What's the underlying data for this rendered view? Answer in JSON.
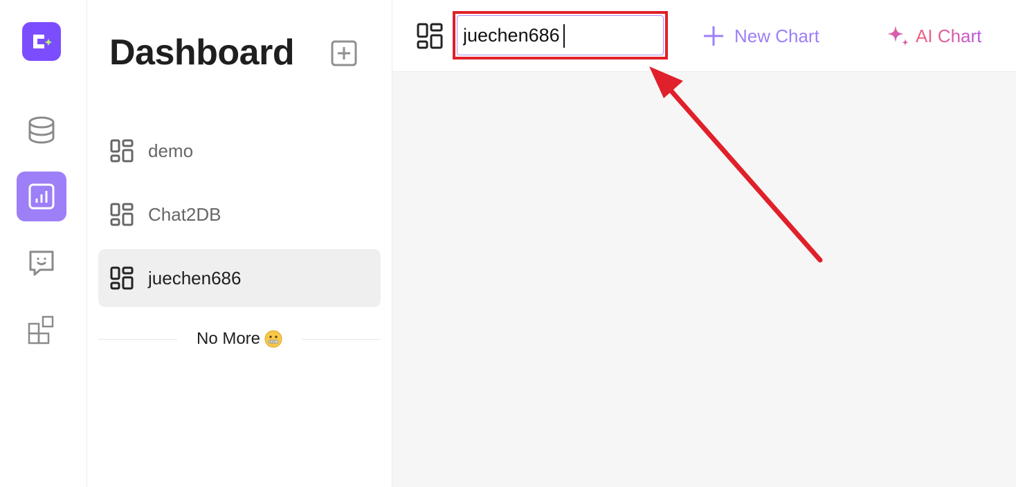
{
  "rail": {
    "items": [
      {
        "name": "logo",
        "icon": "chat2db-logo-icon"
      },
      {
        "name": "database",
        "icon": "database-icon"
      },
      {
        "name": "dashboard",
        "icon": "bar-chart-icon",
        "active": true
      },
      {
        "name": "chat",
        "icon": "chat-bubble-icon"
      },
      {
        "name": "plugins",
        "icon": "puzzle-blocks-icon"
      }
    ],
    "colors": {
      "active_bg": "#9d7ff7",
      "logo_bg": "#7c4dff",
      "logo_accent": "#b5f56a"
    }
  },
  "panel": {
    "title": "Dashboard",
    "add_button_icon": "plus-square-icon",
    "items": [
      {
        "label": "demo",
        "icon": "dashboard-layout-icon",
        "selected": false
      },
      {
        "label": "Chat2DB",
        "icon": "dashboard-layout-icon",
        "selected": false
      },
      {
        "label": "juechen686",
        "icon": "dashboard-layout-icon",
        "selected": true
      }
    ],
    "footer": {
      "text": "No More",
      "emoji": "zipper-mouth-face-emoji"
    }
  },
  "topbar": {
    "icon": "dashboard-layout-icon",
    "name_input_value": "juechen686",
    "new_chart_label": "New Chart",
    "ai_chart_label": "AI Chart",
    "colors": {
      "accent": "#9d7ff7",
      "highlight_box": "#e0202a",
      "arrow": "#e0202a"
    }
  }
}
